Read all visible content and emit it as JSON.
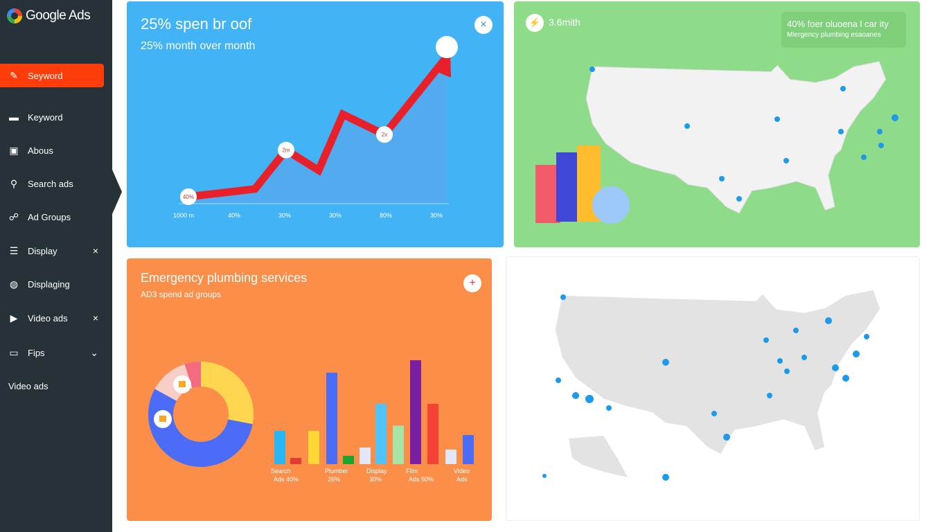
{
  "sidebar": {
    "logo": "Google Ads",
    "items": [
      {
        "label": "Seyword",
        "icon": "pin-icon",
        "active": true
      },
      {
        "label": "Keyword",
        "icon": "monitor-icon"
      },
      {
        "label": "Abous",
        "icon": "image-icon"
      },
      {
        "label": "Search ads",
        "icon": "search-icon"
      },
      {
        "label": "Ad Groups",
        "icon": "group-icon"
      },
      {
        "label": "Display",
        "icon": "layout-icon",
        "trail": "×"
      },
      {
        "label": "Displaging",
        "icon": "globe-icon"
      },
      {
        "label": "Video ads",
        "icon": "video-icon",
        "trail": "×"
      },
      {
        "label": "Fips",
        "icon": "chat-icon",
        "trail": "⌄"
      },
      {
        "label": "Video ads"
      }
    ]
  },
  "card_spend": {
    "title": "25% spen br oof",
    "subtitle": "25% month over month",
    "close": "×",
    "color": "#42b4f5"
  },
  "card_map": {
    "label": "3.6mith",
    "badge_title": "40% foer oluoena l car ity",
    "badge_sub": "Mlergency plumbing esaoanes",
    "color": "#8edc8a"
  },
  "card_services": {
    "title": "Emergency plumbing services",
    "subtitle": "AD3 spend ad groups",
    "add": "+",
    "color": "#fb8f4a"
  },
  "chart_data": [
    {
      "type": "line",
      "x_ticks": [
        "1000 m",
        "40%",
        "30%",
        "30%",
        "80%",
        "30%"
      ],
      "values": [
        5,
        10,
        35,
        22,
        58,
        45,
        95
      ],
      "point_labels": [
        "40%",
        "2m",
        "2x",
        ""
      ],
      "line_color": "#e8202a",
      "ylim": [
        0,
        100
      ]
    },
    {
      "type": "pie",
      "subtype": "donut",
      "values": [
        28,
        55,
        12,
        5
      ],
      "colors": [
        "#fdd54f",
        "#4a6cf7",
        "#f8cfc8",
        "#f46a80"
      ]
    },
    {
      "type": "bar",
      "categories": [
        "Search Ads 40%",
        "Plumber 26%",
        "Display 30%",
        "Film Ads 50%",
        "Video Ads"
      ],
      "values": [
        32,
        6,
        32,
        88,
        8,
        16,
        58,
        37,
        100,
        58,
        14,
        28
      ],
      "colors": [
        "#29b6f6",
        "#e53935",
        "#fdd835",
        "#4a6cf7",
        "#1aa52d",
        "#e3e8f8",
        "#4fc3f7",
        "#a5e6a6",
        "#7b1fa2",
        "#f44336",
        "#e3e8f8",
        "#4a6cf7"
      ]
    }
  ]
}
